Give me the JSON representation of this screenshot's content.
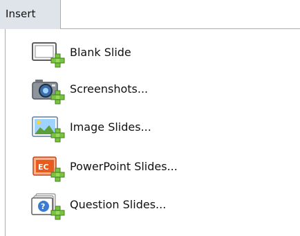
{
  "menu": {
    "title": "Insert",
    "items": [
      {
        "label": "Blank Slide",
        "icon": "blank-slide-add-icon"
      },
      {
        "label": "Screenshots...",
        "icon": "camera-add-icon"
      },
      {
        "label": "Image Slides...",
        "icon": "image-slide-add-icon"
      },
      {
        "label": "PowerPoint Slides...",
        "icon": "powerpoint-slide-add-icon"
      },
      {
        "label": "Question Slides...",
        "icon": "question-slide-add-icon"
      }
    ]
  },
  "colors": {
    "header_background": "#dfe3ea",
    "divider": "#a7adb6",
    "plus_badge": "#7bc142",
    "powerpoint_orange": "#e85b1f"
  }
}
